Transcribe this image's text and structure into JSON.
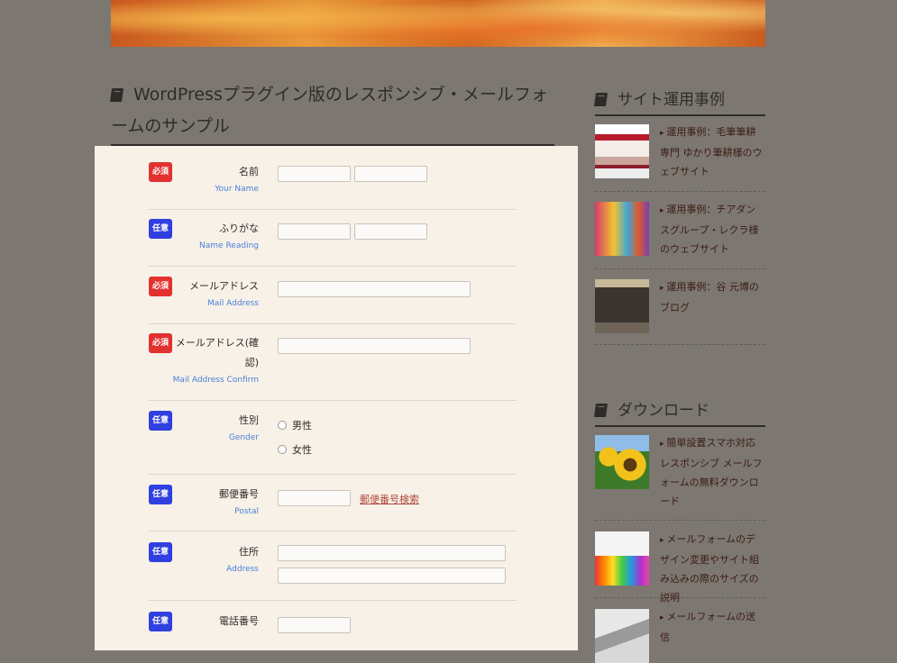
{
  "post": {
    "title": "WordPressプラグイン版のレスポンシブ・メールフォームのサンプル"
  },
  "form": {
    "badges": {
      "required": "必須",
      "optional": "任意"
    },
    "name": {
      "label": "名前",
      "sub": "Your Name"
    },
    "reading": {
      "label": "ふりがな",
      "sub": "Name Reading"
    },
    "mail": {
      "label": "メールアドレス",
      "sub": "Mail Address"
    },
    "mail_confirm": {
      "label1": "メールアドレス(確",
      "label2": "認)",
      "sub": "Mail Address Confirm"
    },
    "gender": {
      "label": "性別",
      "sub": "Gender",
      "options": [
        "男性",
        "女性"
      ]
    },
    "postal": {
      "label": "郵便番号",
      "sub": "Postal",
      "search_link": "郵便番号検索"
    },
    "address": {
      "label": "住所",
      "sub": "Address"
    },
    "phone": {
      "label": "電話番号"
    }
  },
  "sidebar": {
    "cases": {
      "heading": "サイト運用事例",
      "items": [
        {
          "text": "運用事例：毛筆筆耕専門 ゆかり筆耕様のウェブサイト",
          "thumb": "website-screenshot-red"
        },
        {
          "text": "運用事例：チアダンスグループ・レクラ様のウェブサイト",
          "thumb": "website-screenshot-colorful"
        },
        {
          "text": "運用事例：谷 元博のブログ",
          "thumb": "website-screenshot-dark"
        }
      ]
    },
    "download": {
      "heading": "ダウンロード",
      "items": [
        {
          "text": "簡単設置スマホ対応レスポンシブ メールフォームの無料ダウンロード",
          "thumb": "sunflower-photo"
        },
        {
          "text": "メールフォームのデザイン変更やサイト組み込みの際のサイズの説明",
          "thumb": "color-pencils-photo"
        },
        {
          "text": "メールフォームの送信",
          "thumb": "laptop-photo"
        }
      ]
    }
  }
}
